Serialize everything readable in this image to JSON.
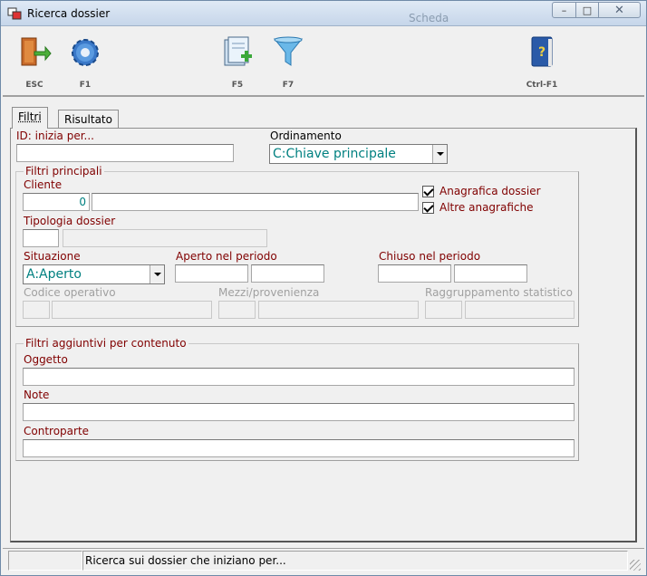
{
  "window": {
    "title": "Ricerca dossier",
    "background_text": "Scheda",
    "minimize": "–",
    "maximize": "□",
    "close": "✕"
  },
  "toolbar": [
    {
      "key": "ESC",
      "icon": "exit-door-icon"
    },
    {
      "key": "F1",
      "icon": "gear-icon"
    },
    {
      "key": "F5",
      "icon": "new-document-icon"
    },
    {
      "key": "F7",
      "icon": "filter-funnel-icon"
    },
    {
      "key": "Ctrl-F1",
      "icon": "help-book-icon"
    }
  ],
  "tabs": [
    {
      "label": "Filtri",
      "active": true
    },
    {
      "label": "Risultato",
      "active": false
    }
  ],
  "form": {
    "id_label": "ID: inizia per...",
    "id_value": "",
    "ordinamento_label": "Ordinamento",
    "ordinamento_value": "C:Chiave principale",
    "filtri_principali_title": "Filtri principali",
    "cliente_label": "Cliente",
    "cliente_code": "0",
    "cliente_name": "",
    "anagrafica_dossier_label": "Anagrafica dossier",
    "anagrafica_dossier_checked": true,
    "altre_anagrafiche_label": "Altre anagrafiche",
    "altre_anagrafiche_checked": true,
    "tipologia_label": "Tipologia dossier",
    "situazione_label": "Situazione",
    "situazione_value": "A:Aperto",
    "aperto_label": "Aperto nel periodo",
    "chiuso_label": "Chiuso nel periodo",
    "codice_operativo_label": "Codice operativo",
    "mezzi_label": "Mezzi/provenienza",
    "raggruppamento_label": "Raggruppamento statistico",
    "filtri_aggiuntivi_title": "Filtri aggiuntivi per contenuto",
    "oggetto_label": "Oggetto",
    "note_label": "Note",
    "controparte_label": "Controparte"
  },
  "statusbar": {
    "message": "Ricerca sui dossier che iniziano per..."
  },
  "colors": {
    "label_maroon": "#800000",
    "value_teal": "#008080"
  }
}
